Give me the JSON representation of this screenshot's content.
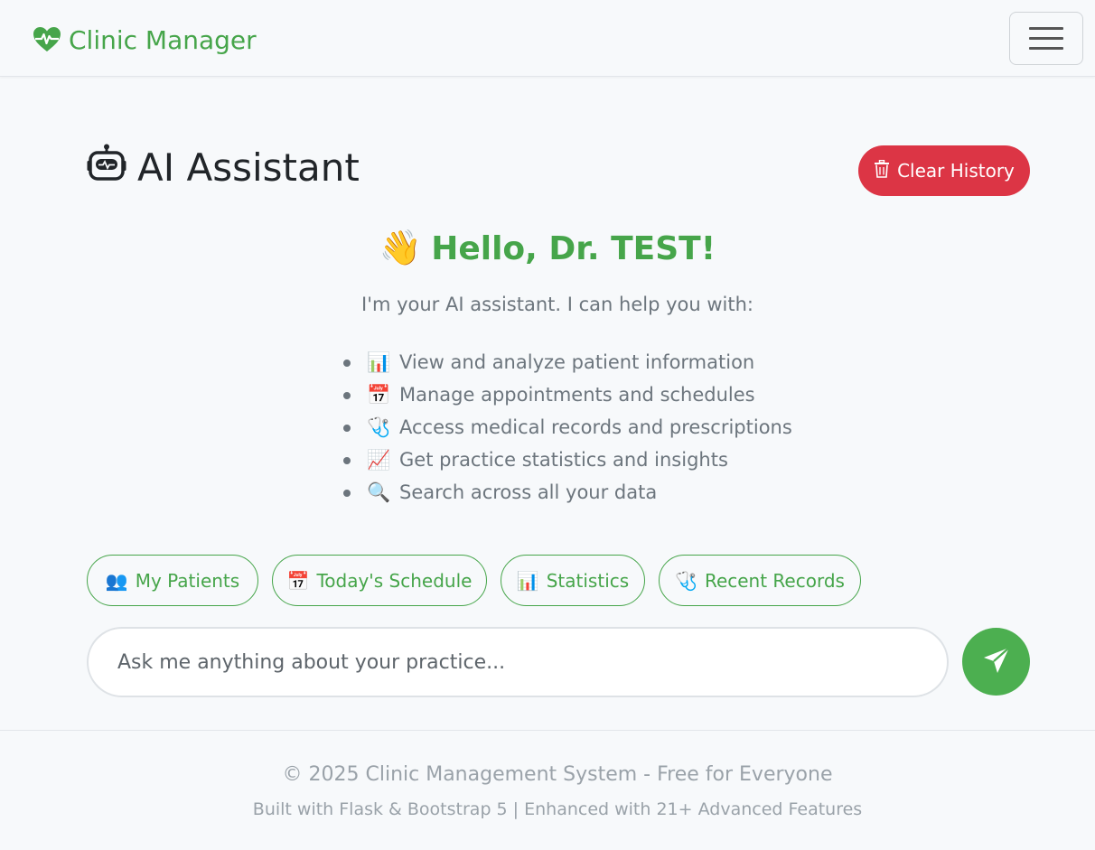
{
  "navbar": {
    "brand": "Clinic Manager",
    "brand_icon": "heart-pulse-icon",
    "toggler_icon": "hamburger-icon"
  },
  "header": {
    "title": "AI Assistant",
    "title_icon": "robot-icon",
    "clear_label": "Clear History",
    "clear_icon": "trash-icon"
  },
  "welcome": {
    "greeting_emoji": "👋",
    "greeting": "Hello, Dr. TEST!",
    "subtitle": "I'm your AI assistant. I can help you with:",
    "features": [
      {
        "icon": "📊",
        "text": "View and analyze patient information"
      },
      {
        "icon": "📅",
        "text": "Manage appointments and schedules"
      },
      {
        "icon": "🩺",
        "text": "Access medical records and prescriptions"
      },
      {
        "icon": "📈",
        "text": "Get practice statistics and insights"
      },
      {
        "icon": "🔍",
        "text": "Search across all your data"
      }
    ]
  },
  "quick_actions": [
    {
      "icon": "👥",
      "label": "My Patients"
    },
    {
      "icon": "📅",
      "label": "Today's Schedule"
    },
    {
      "icon": "📊",
      "label": "Statistics"
    },
    {
      "icon": "🩺",
      "label": "Recent Records"
    }
  ],
  "chat": {
    "placeholder": "Ask me anything about your practice...",
    "value": "",
    "send_icon": "send-icon"
  },
  "footer": {
    "line1": "© 2025 Clinic Management System - Free for Everyone",
    "line2": "Built with Flask & Bootstrap 5 | Enhanced with 21+ Advanced Features"
  },
  "colors": {
    "primary": "#46a54a",
    "danger": "#dc3545",
    "send": "#4caf50",
    "muted": "#6c757d"
  }
}
